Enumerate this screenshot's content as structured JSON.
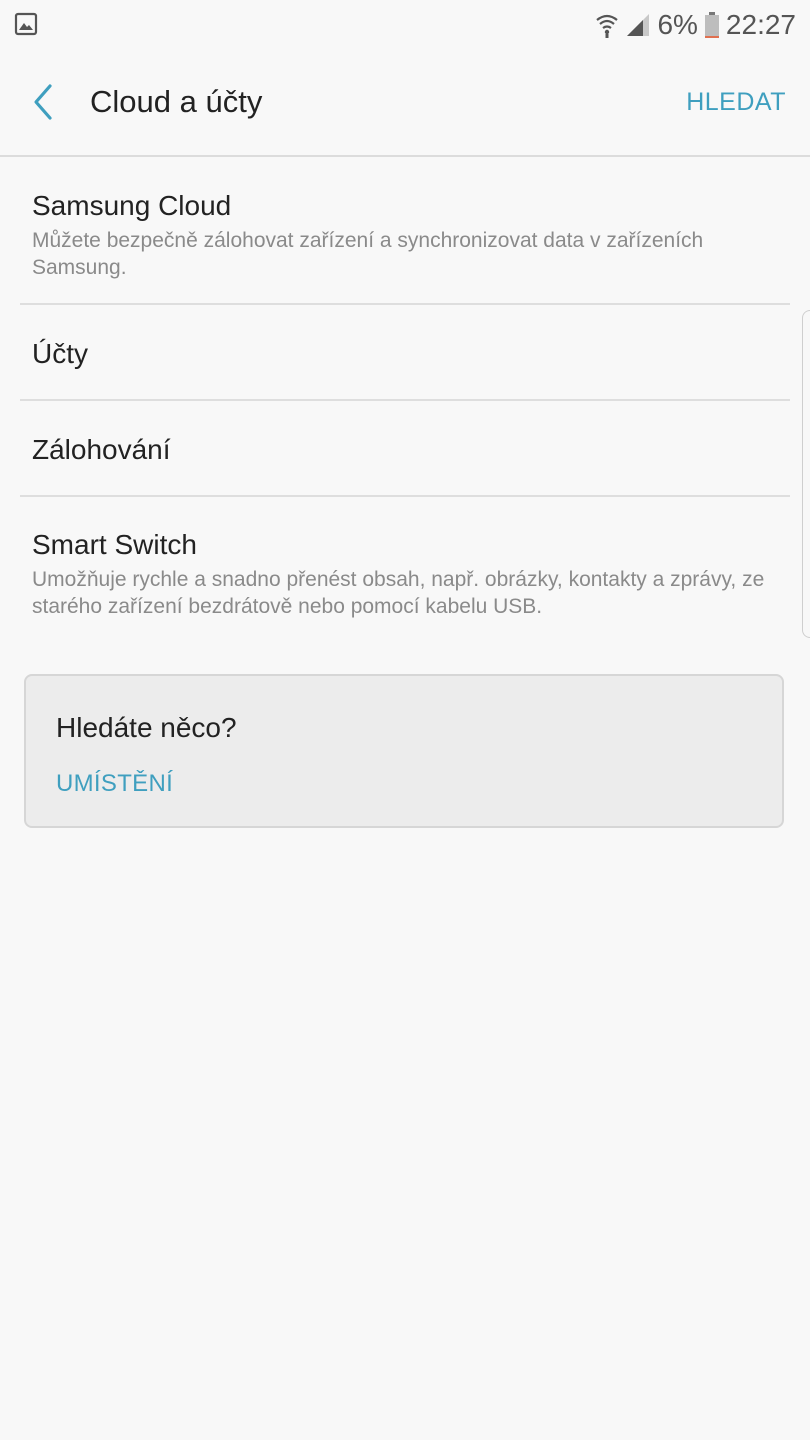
{
  "status_bar": {
    "battery_percent": "6%",
    "time": "22:27",
    "left_icon": "gallery-notification-icon",
    "icons": [
      "wifi-icon",
      "signal-icon",
      "battery-icon"
    ],
    "battery_level": 0.06
  },
  "app_bar": {
    "title": "Cloud a účty",
    "search_label": "HLEDAT",
    "back_icon": "back-arrow-icon"
  },
  "settings": {
    "items": [
      {
        "title": "Samsung Cloud",
        "description": "Můžete bezpečně zálohovat zařízení a synchronizovat data v zařízeních Samsung."
      },
      {
        "title": "Účty"
      },
      {
        "title": "Zálohování"
      },
      {
        "title": "Smart Switch",
        "description": "Umožňuje rychle a snadno přenést obsah, např. obrázky, kontakty a zprávy, ze starého zařízení bezdrátově nebo pomocí kabelu USB."
      }
    ]
  },
  "suggestion_card": {
    "title": "Hledáte něco?",
    "link_label": "UMÍSTĚNÍ"
  },
  "colors": {
    "accent": "#3f9fbf",
    "background": "#f8f8f8",
    "card_background": "#ececec",
    "battery_low": "#e07050"
  }
}
